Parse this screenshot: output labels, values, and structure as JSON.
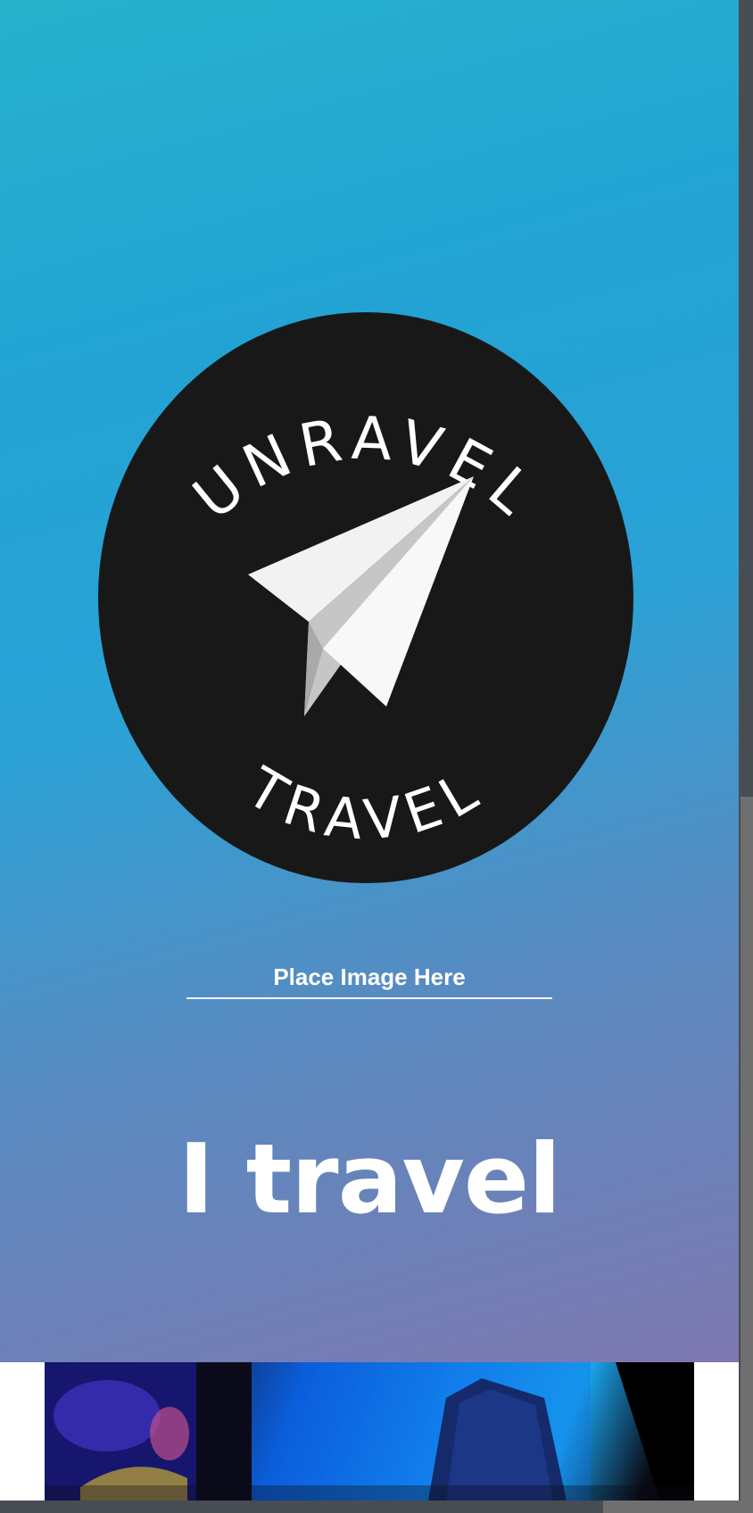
{
  "logo": {
    "top_text": "UNRAVEL",
    "bottom_text": "TRAVEL"
  },
  "placeholder": {
    "label": "Place Image Here"
  },
  "headline": {
    "text": "I travel"
  },
  "colors": {
    "gradient_top": "#27b2cc",
    "gradient_mid": "#2aa2d6",
    "gradient_bottom": "#7e78b0",
    "logo_badge": "#181818",
    "text": "#ffffff",
    "scrollbar_track": "#474d52",
    "scrollbar_thumb": "#6f6f6f"
  },
  "icons": {
    "logo": "paper-plane-icon"
  }
}
